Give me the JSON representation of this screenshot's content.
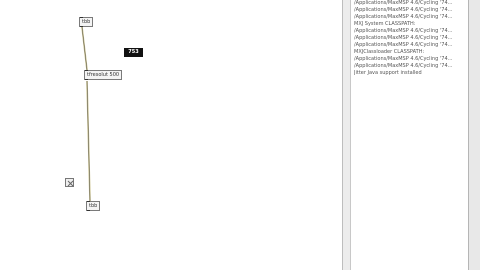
{
  "patcher": {
    "object_top": "tbb",
    "object_middle": "tfresolut 500",
    "object_bottom": "tbb",
    "number_value": "753"
  },
  "console": {
    "lines": [
      "/Applications/MaxMSP 4.6/Cycling '74...",
      "/Applications/MaxMSP 4.6/Cycling '74...",
      "/Applications/MaxMSP 4.6/Cycling '74...",
      "MXJ System CLASSPATH:",
      "  /Applications/MaxMSP 4.6/Cycling '74...",
      "  /Applications/MaxMSP 4.6/Cycling '74...",
      "  /Applications/MaxMSP 4.6/Cycling '74...",
      "MXJClassloader CLASSPATH:",
      "  /Applications/MaxMSP 4.6/Cycling '74...",
      "  /Applications/MaxMSP 4.6/Cycling '74...",
      "Jitter Java support installed"
    ]
  }
}
